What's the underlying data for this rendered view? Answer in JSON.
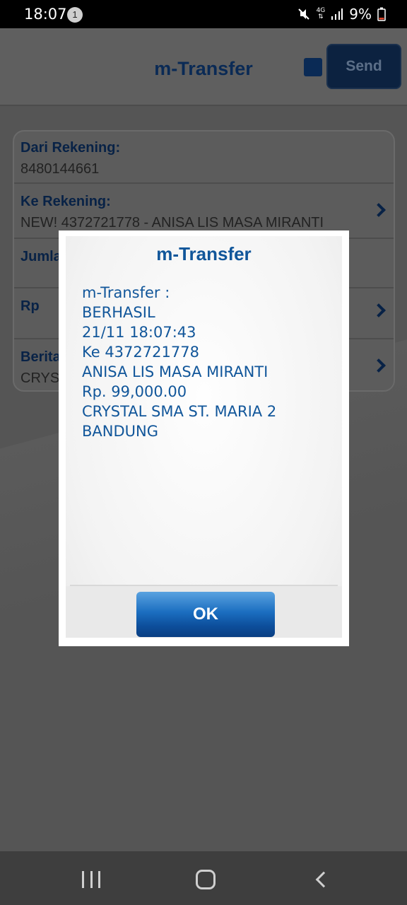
{
  "status_bar": {
    "time": "18:07",
    "notification_count": "1",
    "network": "4G",
    "battery": "9%",
    "icons": [
      "mute-icon",
      "network-4g-icon",
      "signal-icon",
      "battery-low-icon"
    ]
  },
  "header": {
    "title": "m-Transfer",
    "send_label": "Send"
  },
  "form": {
    "rows": [
      {
        "label": "Dari Rekening:",
        "value": "8480144661"
      },
      {
        "label": "Ke Rekening:",
        "value": "NEW! 4372721778 - ANISA LIS MASA MIRANTI"
      },
      {
        "label": "Jumla",
        "value": ""
      },
      {
        "label": "Rp",
        "value": ""
      },
      {
        "label": "Berita",
        "value": "CRYS"
      }
    ]
  },
  "dialog": {
    "title": "m-Transfer",
    "lines": [
      "m-Transfer :",
      "BERHASIL",
      "21/11 18:07:43",
      "Ke 4372721778",
      "ANISA LIS MASA MIRANTI",
      "Rp. 99,000.00",
      "CRYSTAL SMA ST. MARIA 2",
      "BANDUNG"
    ],
    "ok_label": "OK"
  },
  "colors": {
    "accent_blue": "#11569a",
    "button_blue": "#1b6ec0",
    "overlay_gray": "#555555"
  }
}
